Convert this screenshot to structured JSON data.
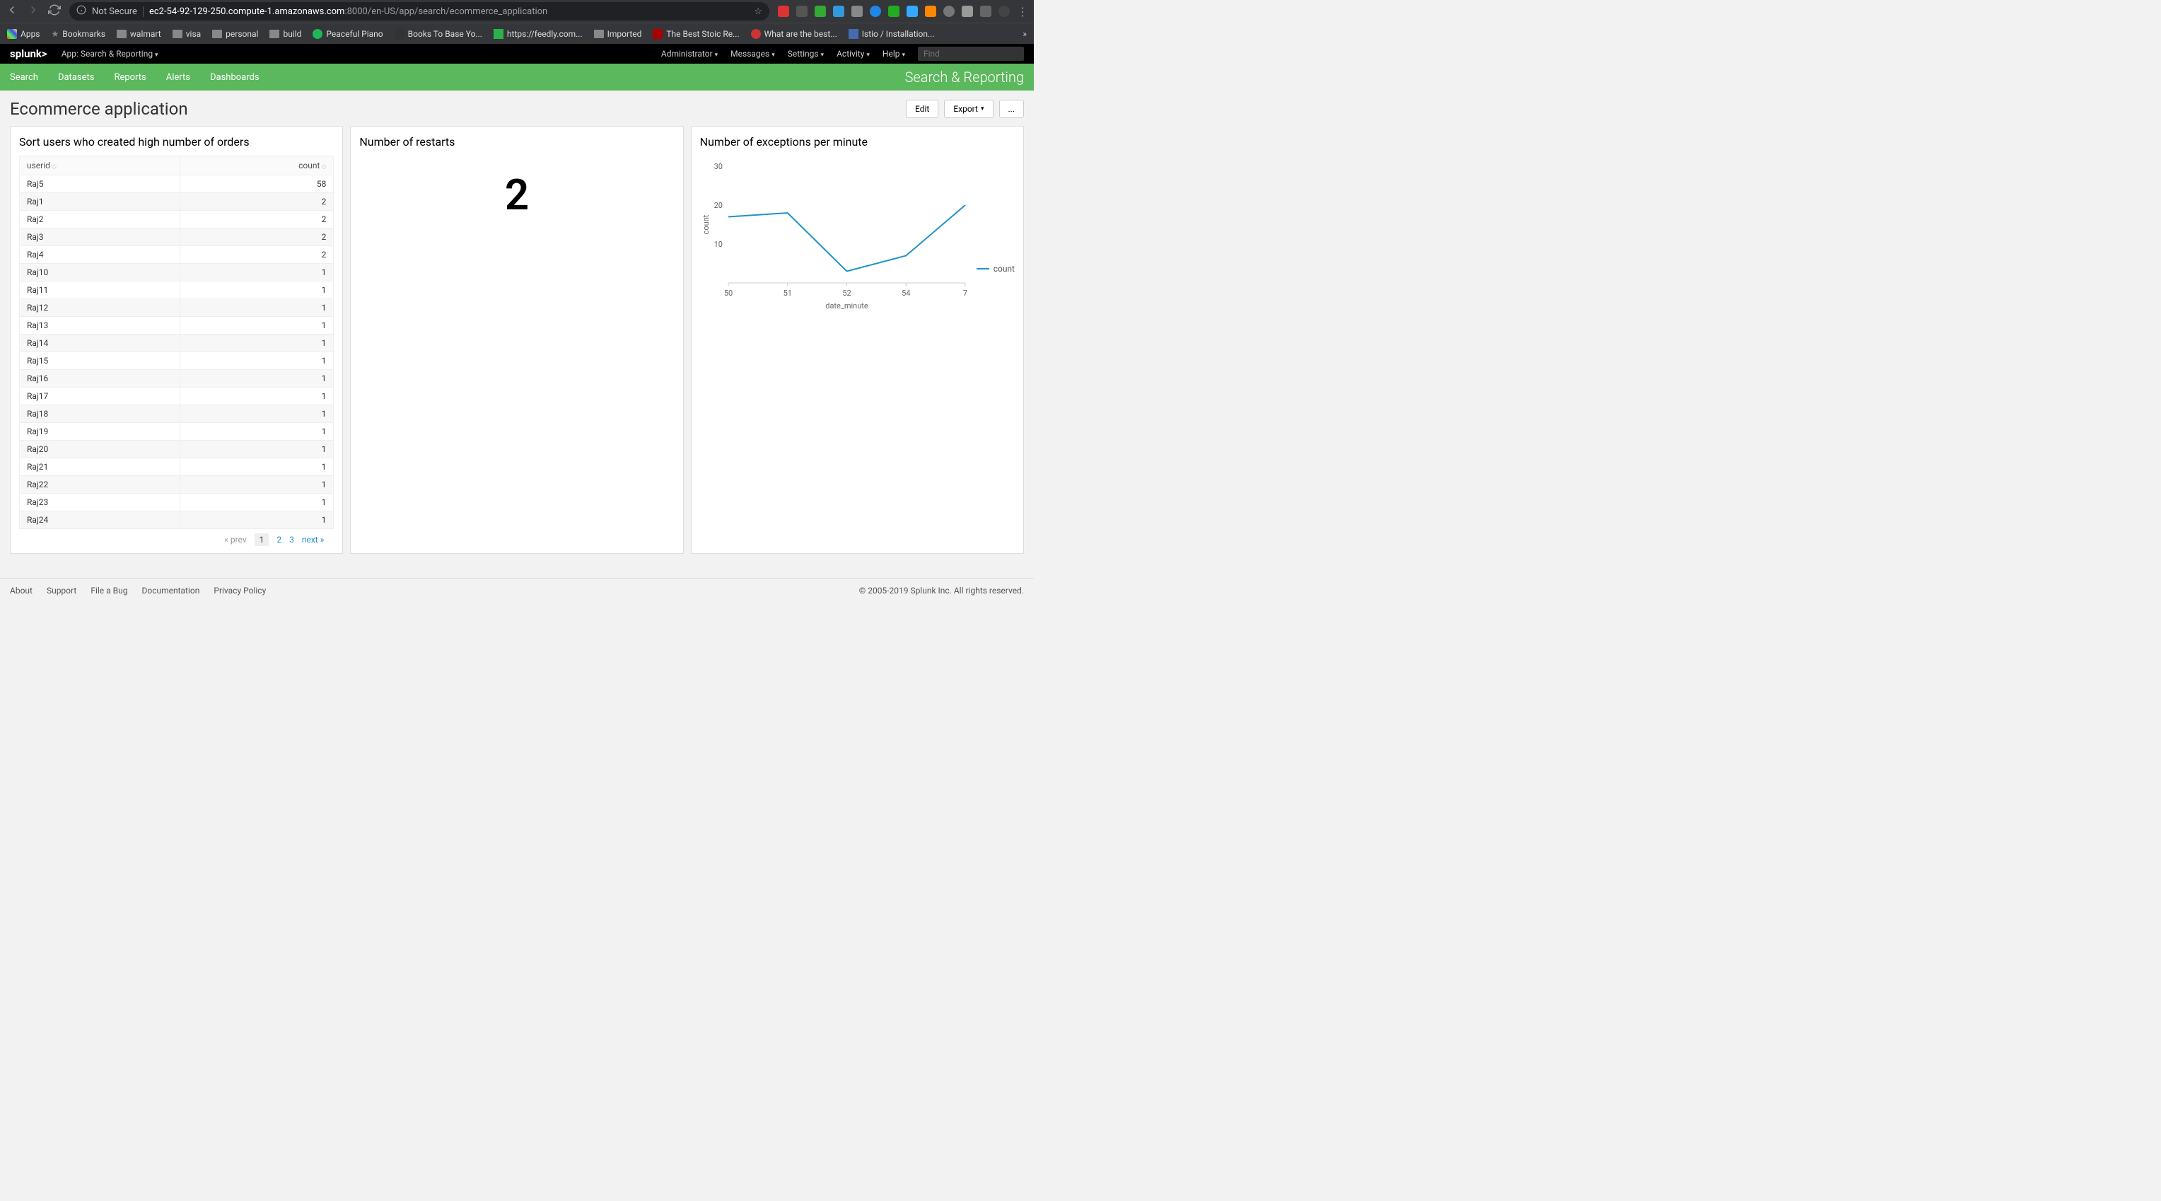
{
  "browser": {
    "not_secure": "Not Secure",
    "url_host": "ec2-54-92-129-250.compute-1.amazonaws.com",
    "url_port_path": ":8000/en-US/app/search/ecommerce_application"
  },
  "bookmarks": [
    "Apps",
    "Bookmarks",
    "walmart",
    "visa",
    "personal",
    "build",
    "Peaceful Piano",
    "Books To Base Yo...",
    "https://feedly.com...",
    "Imported",
    "The Best Stoic Re...",
    "What are the best...",
    "Istio / Installation..."
  ],
  "splunk_header": {
    "logo": "splunk>",
    "app_label": "App: Search & Reporting",
    "right": [
      "Administrator",
      "Messages",
      "Settings",
      "Activity",
      "Help"
    ],
    "find_placeholder": "Find"
  },
  "green_nav": {
    "items": [
      "Search",
      "Datasets",
      "Reports",
      "Alerts",
      "Dashboards"
    ],
    "right": "Search & Reporting"
  },
  "page": {
    "title": "Ecommerce application",
    "edit": "Edit",
    "export": "Export",
    "more": "..."
  },
  "panel1": {
    "title": "Sort users who created high number of orders",
    "col_userid": "userid",
    "col_count": "count",
    "rows": [
      {
        "userid": "Raj5",
        "count": "58"
      },
      {
        "userid": "Raj1",
        "count": "2"
      },
      {
        "userid": "Raj2",
        "count": "2"
      },
      {
        "userid": "Raj3",
        "count": "2"
      },
      {
        "userid": "Raj4",
        "count": "2"
      },
      {
        "userid": "Raj10",
        "count": "1"
      },
      {
        "userid": "Raj11",
        "count": "1"
      },
      {
        "userid": "Raj12",
        "count": "1"
      },
      {
        "userid": "Raj13",
        "count": "1"
      },
      {
        "userid": "Raj14",
        "count": "1"
      },
      {
        "userid": "Raj15",
        "count": "1"
      },
      {
        "userid": "Raj16",
        "count": "1"
      },
      {
        "userid": "Raj17",
        "count": "1"
      },
      {
        "userid": "Raj18",
        "count": "1"
      },
      {
        "userid": "Raj19",
        "count": "1"
      },
      {
        "userid": "Raj20",
        "count": "1"
      },
      {
        "userid": "Raj21",
        "count": "1"
      },
      {
        "userid": "Raj22",
        "count": "1"
      },
      {
        "userid": "Raj23",
        "count": "1"
      },
      {
        "userid": "Raj24",
        "count": "1"
      }
    ],
    "pagination": {
      "prev": "« prev",
      "p1": "1",
      "p2": "2",
      "p3": "3",
      "next": "next »"
    }
  },
  "panel2": {
    "title": "Number of restarts",
    "value": "2"
  },
  "panel3": {
    "title": "Number of exceptions per minute",
    "legend": "count",
    "xlabel": "date_minute",
    "ylabel": "count",
    "y_ticks": [
      "30",
      "20",
      "10"
    ],
    "x_ticks": [
      "50",
      "51",
      "52",
      "54",
      "7"
    ]
  },
  "chart_data": {
    "type": "line",
    "title": "Number of exceptions per minute",
    "xlabel": "date_minute",
    "ylabel": "count",
    "ylim": [
      0,
      30
    ],
    "series": [
      {
        "name": "count",
        "x": [
          "50",
          "51",
          "52",
          "54",
          "7"
        ],
        "values": [
          17,
          18,
          3,
          7,
          20
        ]
      }
    ]
  },
  "footer": {
    "links": [
      "About",
      "Support",
      "File a Bug",
      "Documentation",
      "Privacy Policy"
    ],
    "copyright": "© 2005-2019 Splunk Inc. All rights reserved."
  }
}
